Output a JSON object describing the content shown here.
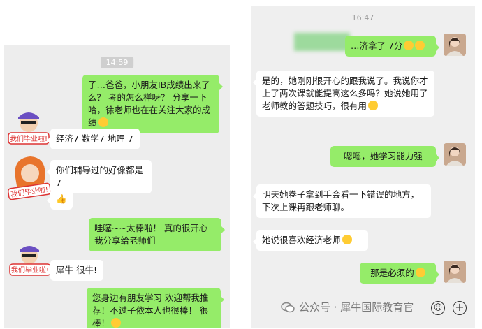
{
  "left_chat": {
    "timestamp": "14:59",
    "messages": [
      {
        "side": "right",
        "text": "子…爸爸，小朋友IB成绩出来了么？ 考的怎么样呀？ 分享一下哈，徐老师也在在关注大家的成绩"
      },
      {
        "side": "left",
        "text": "经济7 数学7   地理 7"
      },
      {
        "side": "left",
        "text": "你们辅导过的好像都是 7"
      },
      {
        "side": "left",
        "text": "👍"
      },
      {
        "side": "right",
        "text": "哇噻~~太棒啦！ 真的很开心 我分享给老师们"
      },
      {
        "side": "left",
        "text": "犀牛 很牛!"
      },
      {
        "side": "right",
        "text": "您身边有朋友学习 欢迎帮我推荐！不过子依本人也很棒！ 很棒！"
      }
    ],
    "sticker_text_1": "我们毕业啦!",
    "sticker_text_2": "我们毕业啦!",
    "sticker_text_3": "我们毕业啦!"
  },
  "right_chat": {
    "timestamp": "16:47",
    "messages": [
      {
        "side": "right",
        "text": "…济拿了 7分"
      },
      {
        "side": "left",
        "text": "是的，她刚刚很开心的跟我说了。我说你才上了两次课就能提高这么多吗？她说她用了老师教的答题技巧，很有用"
      },
      {
        "side": "right",
        "text": "嗯嗯，她学习能力强"
      },
      {
        "side": "left",
        "text": "明天她卷子拿到手会看一下错误的地方，下次上课再跟老师聊。"
      },
      {
        "side": "left",
        "text": "她说很喜欢经济老师"
      },
      {
        "side": "right",
        "text": "那是必须的"
      }
    ]
  },
  "watermark": "公众号 · 犀牛国际教育官",
  "icons": {
    "wechat": "wechat-logo-icon",
    "emoji": "emoji-icon",
    "plus": "plus-icon"
  },
  "colors": {
    "green_bubble": "#95ec69",
    "chat_bg": "#ededed",
    "white_bubble": "#ffffff"
  }
}
